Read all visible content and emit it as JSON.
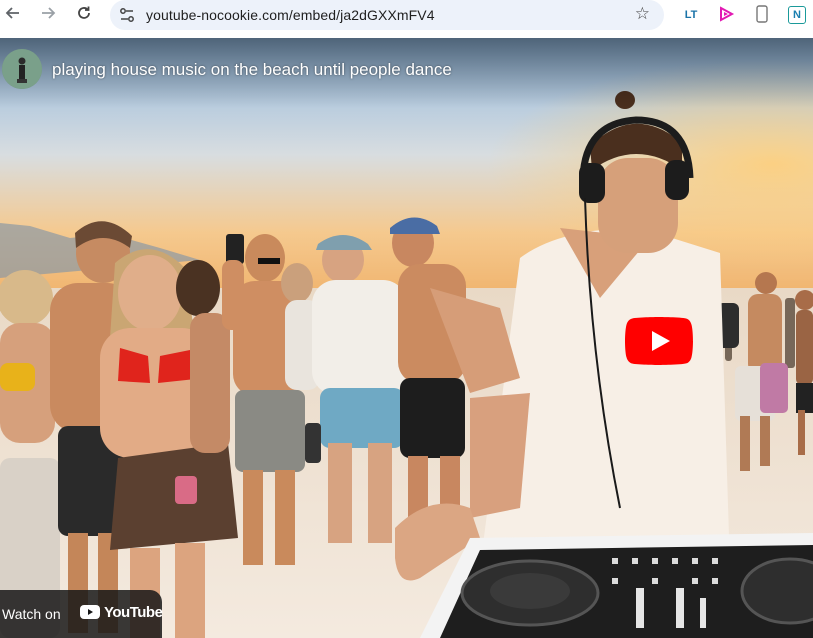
{
  "browser": {
    "url": "youtube-nocookie.com/embed/ja2dGXXmFV4",
    "back_icon": "arrow-left-icon",
    "forward_icon": "arrow-right-icon",
    "reload_icon": "reload-icon",
    "bookmark_icon": "star-icon",
    "extensions": [
      {
        "name": "languagetool-extension-icon",
        "label": "LT"
      },
      {
        "name": "play-extension-icon",
        "label": ""
      },
      {
        "name": "phone-extension-icon",
        "label": ""
      },
      {
        "name": "n-extension-icon",
        "label": "N"
      }
    ]
  },
  "video": {
    "title": "playing house music on the beach until people dance",
    "watch_on_label": "Watch on",
    "brand_label": "YouTube",
    "colors": {
      "play_red": "#ff0000",
      "sky_top": "#9fc2e4",
      "sky_bottom": "#f6c58a",
      "sand": "#efe3d4"
    }
  }
}
